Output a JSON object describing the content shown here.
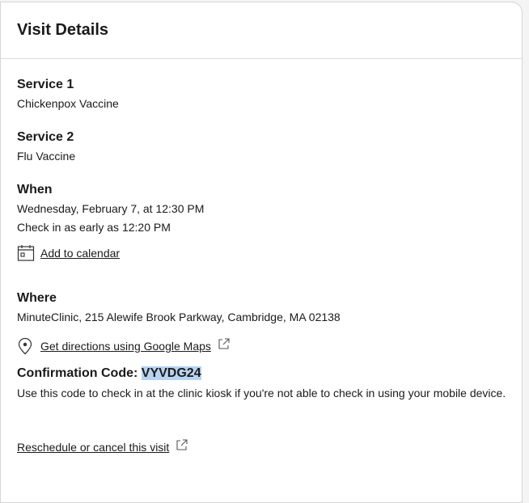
{
  "header": {
    "title": "Visit Details"
  },
  "services": [
    {
      "label": "Service 1",
      "value": "Chickenpox Vaccine"
    },
    {
      "label": "Service 2",
      "value": "Flu Vaccine"
    }
  ],
  "when": {
    "label": "When",
    "datetime": "Wednesday, February 7, at 12:30 PM",
    "checkin": "Check in as early as 12:20 PM",
    "add_calendar": "Add to calendar",
    "icon": "calendar-icon"
  },
  "where": {
    "label": "Where",
    "address": "MinuteClinic, 215 Alewife Brook Parkway, Cambridge, MA 02138",
    "directions": "Get directions using Google Maps",
    "icon": "map-pin-icon"
  },
  "confirmation": {
    "label": "Confirmation Code:",
    "code": "VYVDG24",
    "note": "Use this code to check in at the clinic kiosk if you're not able to check in using your mobile device."
  },
  "reschedule": {
    "label": "Reschedule or cancel this visit"
  }
}
